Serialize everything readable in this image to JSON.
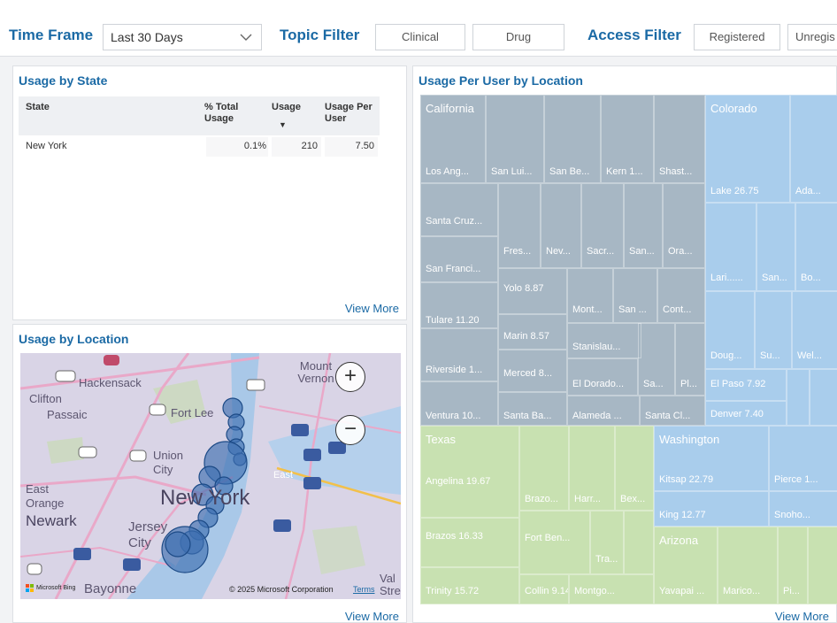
{
  "filters": {
    "time_frame_title": "Time Frame",
    "time_frame_value": "Last 30 Days",
    "topic_filter_title": "Topic Filter",
    "topic_options": [
      "Clinical",
      "Drug"
    ],
    "access_filter_title": "Access Filter",
    "access_options": [
      "Registered",
      "Unregis"
    ]
  },
  "usage_by_state": {
    "title": "Usage by State",
    "columns": [
      "State",
      "% Total Usage",
      "Usage",
      "Usage Per User"
    ],
    "sort_indicator": "▼",
    "rows": [
      {
        "state": "New York",
        "pct": "0.1%",
        "usage": "210",
        "per_user": "7.50"
      }
    ],
    "view_more": "View More"
  },
  "usage_by_location": {
    "title": "Usage by Location",
    "map_labels": {
      "hackensack": "Hackensack",
      "clifton": "Clifton",
      "passaic": "Passaic",
      "fort_lee": "Fort Lee",
      "mount_vernon": "Mount Vernon",
      "union_city": "Union City",
      "east_orange": "East Orange",
      "newark": "Newark",
      "jersey_city": "Jersey City",
      "bayonne": "Bayonne",
      "new_york": "New York",
      "east": "East",
      "val_stre": "Val Stre"
    },
    "zoom_in": "+",
    "zoom_out": "−",
    "attribution": "© 2025 Microsoft Corporation",
    "terms": "Terms",
    "ms_brand": "Microsoft Bing",
    "view_more": "View More"
  },
  "usage_per_user": {
    "title": "Usage Per User by Location",
    "groups": {
      "california": "California",
      "colorado": "Colorado",
      "texas": "Texas",
      "washington": "Washington",
      "arizona": "Arizona"
    },
    "cells": {
      "los_angeles": "Los Ang...",
      "san_luis": "San Lui...",
      "san_bernardino": "San Be...",
      "kern": "Kern 1...",
      "shasta": "Shast...",
      "santa_cruz": "Santa Cruz...",
      "fresno": "Fres...",
      "nevada": "Nev...",
      "sacramento": "Sacr...",
      "san_x": "San...",
      "orange": "Ora...",
      "san_francisco": "San Franci...",
      "yolo": "Yolo 8.87",
      "monterey": "Mont...",
      "san_y": "San ...",
      "contra": "Cont...",
      "tulare": "Tulare 11.20",
      "marin": "Marin 8.57",
      "stanislaus": "Stanislau...",
      "riverside": "Riverside 1...",
      "merced": "Merced 8...",
      "el_dorado": "El Dorado...",
      "sa": "Sa...",
      "pl": "Pl...",
      "ventura": "Ventura 10...",
      "santa_barbara": "Santa Ba...",
      "alameda": "Alameda ...",
      "santa_clara": "Santa Cl...",
      "lake": "Lake 26.75",
      "adams": "Ada...",
      "larimer": "Lari......",
      "san_co": "San...",
      "boulder": "Bo...",
      "douglas": "Doug...",
      "summit": "Su...",
      "weld": "Wel...",
      "el_paso": "El Paso 7.92",
      "denver": "Denver 7.40",
      "angelina": "Angelina 19.67",
      "brazoria": "Brazo...",
      "harris": "Harr...",
      "bexar": "Bex...",
      "brazos": "Brazos 16.33",
      "fort_bend": "Fort Ben...",
      "travis": "Tra...",
      "trinity": "Trinity 15.72",
      "collin": "Collin 9.14",
      "montgomery": "Montgo...",
      "kitsap": "Kitsap 22.79",
      "pierce": "Pierce 1...",
      "king": "King 12.77",
      "snohomish": "Snoho...",
      "yavapai": "Yavapai ...",
      "maricopa": "Marico...",
      "pima": "Pi..."
    },
    "colors": {
      "california": "#a7b7c4",
      "colorado": "#a9cdec",
      "texas": "#c8e1b1",
      "washington": "#a9cdec",
      "arizona": "#c8e1b1"
    },
    "view_more": "View More"
  }
}
